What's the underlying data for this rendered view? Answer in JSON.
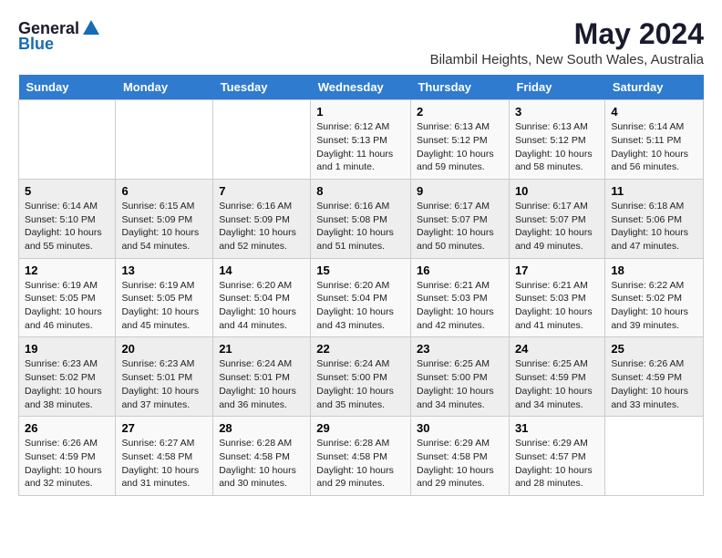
{
  "logo": {
    "general": "General",
    "blue": "Blue"
  },
  "title": "May 2024",
  "location": "Bilambil Heights, New South Wales, Australia",
  "days_of_week": [
    "Sunday",
    "Monday",
    "Tuesday",
    "Wednesday",
    "Thursday",
    "Friday",
    "Saturday"
  ],
  "weeks": [
    [
      {
        "day": "",
        "sunrise": "",
        "sunset": "",
        "daylight": ""
      },
      {
        "day": "",
        "sunrise": "",
        "sunset": "",
        "daylight": ""
      },
      {
        "day": "",
        "sunrise": "",
        "sunset": "",
        "daylight": ""
      },
      {
        "day": "1",
        "sunrise": "Sunrise: 6:12 AM",
        "sunset": "Sunset: 5:13 PM",
        "daylight": "Daylight: 11 hours and 1 minute."
      },
      {
        "day": "2",
        "sunrise": "Sunrise: 6:13 AM",
        "sunset": "Sunset: 5:12 PM",
        "daylight": "Daylight: 10 hours and 59 minutes."
      },
      {
        "day": "3",
        "sunrise": "Sunrise: 6:13 AM",
        "sunset": "Sunset: 5:12 PM",
        "daylight": "Daylight: 10 hours and 58 minutes."
      },
      {
        "day": "4",
        "sunrise": "Sunrise: 6:14 AM",
        "sunset": "Sunset: 5:11 PM",
        "daylight": "Daylight: 10 hours and 56 minutes."
      }
    ],
    [
      {
        "day": "5",
        "sunrise": "Sunrise: 6:14 AM",
        "sunset": "Sunset: 5:10 PM",
        "daylight": "Daylight: 10 hours and 55 minutes."
      },
      {
        "day": "6",
        "sunrise": "Sunrise: 6:15 AM",
        "sunset": "Sunset: 5:09 PM",
        "daylight": "Daylight: 10 hours and 54 minutes."
      },
      {
        "day": "7",
        "sunrise": "Sunrise: 6:16 AM",
        "sunset": "Sunset: 5:09 PM",
        "daylight": "Daylight: 10 hours and 52 minutes."
      },
      {
        "day": "8",
        "sunrise": "Sunrise: 6:16 AM",
        "sunset": "Sunset: 5:08 PM",
        "daylight": "Daylight: 10 hours and 51 minutes."
      },
      {
        "day": "9",
        "sunrise": "Sunrise: 6:17 AM",
        "sunset": "Sunset: 5:07 PM",
        "daylight": "Daylight: 10 hours and 50 minutes."
      },
      {
        "day": "10",
        "sunrise": "Sunrise: 6:17 AM",
        "sunset": "Sunset: 5:07 PM",
        "daylight": "Daylight: 10 hours and 49 minutes."
      },
      {
        "day": "11",
        "sunrise": "Sunrise: 6:18 AM",
        "sunset": "Sunset: 5:06 PM",
        "daylight": "Daylight: 10 hours and 47 minutes."
      }
    ],
    [
      {
        "day": "12",
        "sunrise": "Sunrise: 6:19 AM",
        "sunset": "Sunset: 5:05 PM",
        "daylight": "Daylight: 10 hours and 46 minutes."
      },
      {
        "day": "13",
        "sunrise": "Sunrise: 6:19 AM",
        "sunset": "Sunset: 5:05 PM",
        "daylight": "Daylight: 10 hours and 45 minutes."
      },
      {
        "day": "14",
        "sunrise": "Sunrise: 6:20 AM",
        "sunset": "Sunset: 5:04 PM",
        "daylight": "Daylight: 10 hours and 44 minutes."
      },
      {
        "day": "15",
        "sunrise": "Sunrise: 6:20 AM",
        "sunset": "Sunset: 5:04 PM",
        "daylight": "Daylight: 10 hours and 43 minutes."
      },
      {
        "day": "16",
        "sunrise": "Sunrise: 6:21 AM",
        "sunset": "Sunset: 5:03 PM",
        "daylight": "Daylight: 10 hours and 42 minutes."
      },
      {
        "day": "17",
        "sunrise": "Sunrise: 6:21 AM",
        "sunset": "Sunset: 5:03 PM",
        "daylight": "Daylight: 10 hours and 41 minutes."
      },
      {
        "day": "18",
        "sunrise": "Sunrise: 6:22 AM",
        "sunset": "Sunset: 5:02 PM",
        "daylight": "Daylight: 10 hours and 39 minutes."
      }
    ],
    [
      {
        "day": "19",
        "sunrise": "Sunrise: 6:23 AM",
        "sunset": "Sunset: 5:02 PM",
        "daylight": "Daylight: 10 hours and 38 minutes."
      },
      {
        "day": "20",
        "sunrise": "Sunrise: 6:23 AM",
        "sunset": "Sunset: 5:01 PM",
        "daylight": "Daylight: 10 hours and 37 minutes."
      },
      {
        "day": "21",
        "sunrise": "Sunrise: 6:24 AM",
        "sunset": "Sunset: 5:01 PM",
        "daylight": "Daylight: 10 hours and 36 minutes."
      },
      {
        "day": "22",
        "sunrise": "Sunrise: 6:24 AM",
        "sunset": "Sunset: 5:00 PM",
        "daylight": "Daylight: 10 hours and 35 minutes."
      },
      {
        "day": "23",
        "sunrise": "Sunrise: 6:25 AM",
        "sunset": "Sunset: 5:00 PM",
        "daylight": "Daylight: 10 hours and 34 minutes."
      },
      {
        "day": "24",
        "sunrise": "Sunrise: 6:25 AM",
        "sunset": "Sunset: 4:59 PM",
        "daylight": "Daylight: 10 hours and 34 minutes."
      },
      {
        "day": "25",
        "sunrise": "Sunrise: 6:26 AM",
        "sunset": "Sunset: 4:59 PM",
        "daylight": "Daylight: 10 hours and 33 minutes."
      }
    ],
    [
      {
        "day": "26",
        "sunrise": "Sunrise: 6:26 AM",
        "sunset": "Sunset: 4:59 PM",
        "daylight": "Daylight: 10 hours and 32 minutes."
      },
      {
        "day": "27",
        "sunrise": "Sunrise: 6:27 AM",
        "sunset": "Sunset: 4:58 PM",
        "daylight": "Daylight: 10 hours and 31 minutes."
      },
      {
        "day": "28",
        "sunrise": "Sunrise: 6:28 AM",
        "sunset": "Sunset: 4:58 PM",
        "daylight": "Daylight: 10 hours and 30 minutes."
      },
      {
        "day": "29",
        "sunrise": "Sunrise: 6:28 AM",
        "sunset": "Sunset: 4:58 PM",
        "daylight": "Daylight: 10 hours and 29 minutes."
      },
      {
        "day": "30",
        "sunrise": "Sunrise: 6:29 AM",
        "sunset": "Sunset: 4:58 PM",
        "daylight": "Daylight: 10 hours and 29 minutes."
      },
      {
        "day": "31",
        "sunrise": "Sunrise: 6:29 AM",
        "sunset": "Sunset: 4:57 PM",
        "daylight": "Daylight: 10 hours and 28 minutes."
      },
      {
        "day": "",
        "sunrise": "",
        "sunset": "",
        "daylight": ""
      }
    ]
  ]
}
